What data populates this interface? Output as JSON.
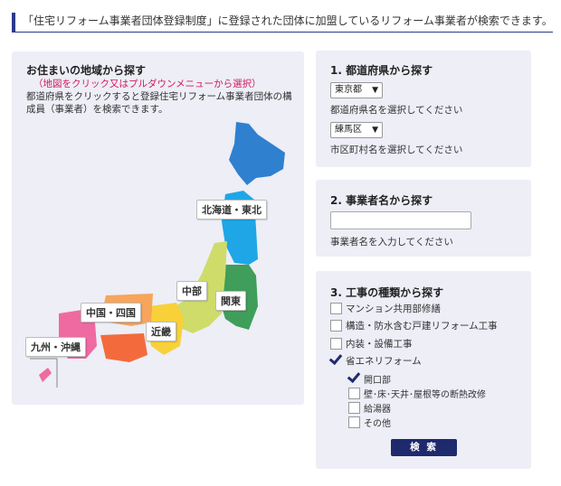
{
  "banner": "「住宅リフォーム事業者団体登録制度」に登録された団体に加盟しているリフォーム事業者が検索できます。",
  "map_section": {
    "title": "お住まいの地域から探す",
    "subtitle": "（地図をクリック又はプルダウンメニューから選択）",
    "description": "都道府県をクリックすると登録住宅リフォーム事業者団体の構成員（事業者）を検索できます。",
    "regions": [
      {
        "label": "北海道・東北",
        "color": "#2f80cf"
      },
      {
        "label": "関東",
        "color": "#3f9e5a"
      },
      {
        "label": "中部",
        "color": "#cfdc6a"
      },
      {
        "label": "近畿",
        "color": "#f8d13a"
      },
      {
        "label": "中国・四国",
        "color": "#f7a55a"
      },
      {
        "label": "九州・沖縄",
        "color": "#ef6aa0"
      }
    ],
    "tohoku_color": "#1fa6e6",
    "kinki_shikoku_color": "#f36b3d"
  },
  "prefecture_search": {
    "title": "1. 都道府県から探す",
    "prefecture_value": "東京都",
    "prefecture_hint": "都道府県名を選択してください",
    "city_value": "練馬区",
    "city_hint": "市区町村名を選択してください"
  },
  "name_search": {
    "title": "2. 事業者名から探す",
    "value": "",
    "hint": "事業者名を入力してください"
  },
  "work_search": {
    "title": "3. 工事の種類から探す",
    "options": [
      {
        "label": "マンション共用部修繕",
        "checked": false
      },
      {
        "label": "構造・防水含む戸建リフォーム工事",
        "checked": false
      },
      {
        "label": "内装・設備工事",
        "checked": false
      },
      {
        "label": "省エネリフォーム",
        "checked": true
      }
    ],
    "sub_options": [
      {
        "label": "開口部",
        "checked": true
      },
      {
        "label": "壁･床･天井･屋根等の断熱改修",
        "checked": false
      },
      {
        "label": "給湯器",
        "checked": false
      },
      {
        "label": "その他",
        "checked": false
      }
    ],
    "button_label": "検 索"
  }
}
